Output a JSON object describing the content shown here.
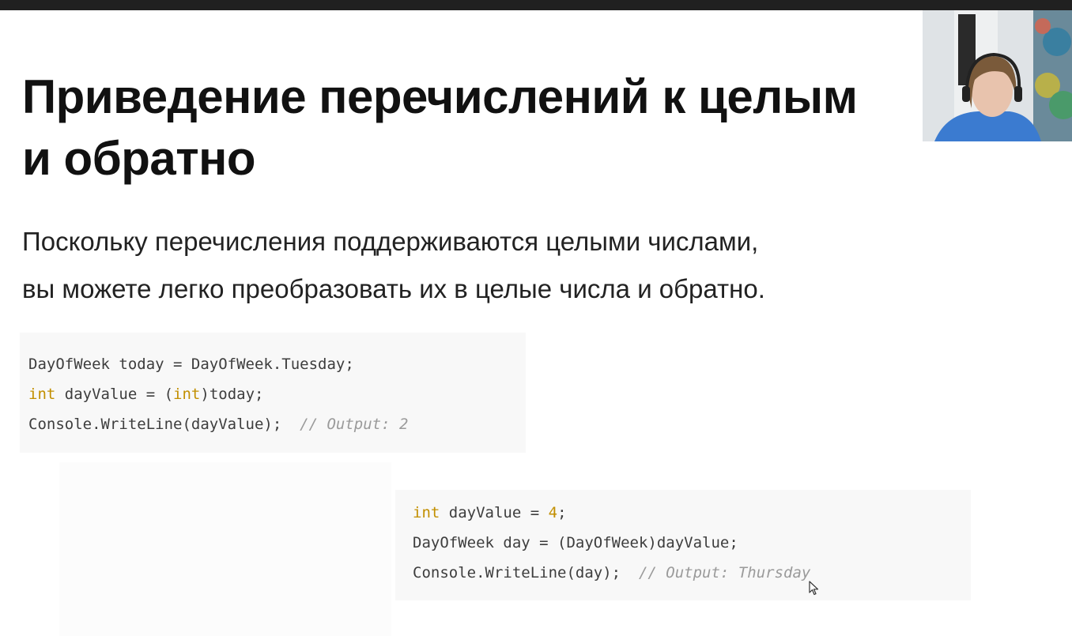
{
  "slide": {
    "title_lines": [
      "Приведение перечислений к целым",
      "и обратно"
    ],
    "body_lines": [
      "Поскольку перечисления поддерживаются целыми числами,",
      "вы можете легко преобразовать их в целые числа и обратно."
    ]
  },
  "code_block_1": {
    "line1": "DayOfWeek today = DayOfWeek.Tuesday;",
    "line2_kw1": "int",
    "line2_mid": " dayValue = (",
    "line2_kw2": "int",
    "line2_end": ")today;",
    "line3_code": "Console.WriteLine(dayValue);  ",
    "line3_comment": "// Output: 2"
  },
  "code_block_2": {
    "line1_kw": "int",
    "line1_mid": " dayValue = ",
    "line1_num": "4",
    "line1_end": ";",
    "line2": "DayOfWeek day = (DayOfWeek)dayValue;",
    "line3_code": "Console.WriteLine(day);  ",
    "line3_comment": "// Output: Thursday"
  },
  "colors": {
    "keyword": "#c28f00",
    "comment": "#9a9a9a",
    "code_background": "#f8f8f8",
    "top_bar": "#202020"
  },
  "icons": {
    "webcam": "presenter-webcam-feed",
    "cursor": "mouse-cursor-icon"
  }
}
